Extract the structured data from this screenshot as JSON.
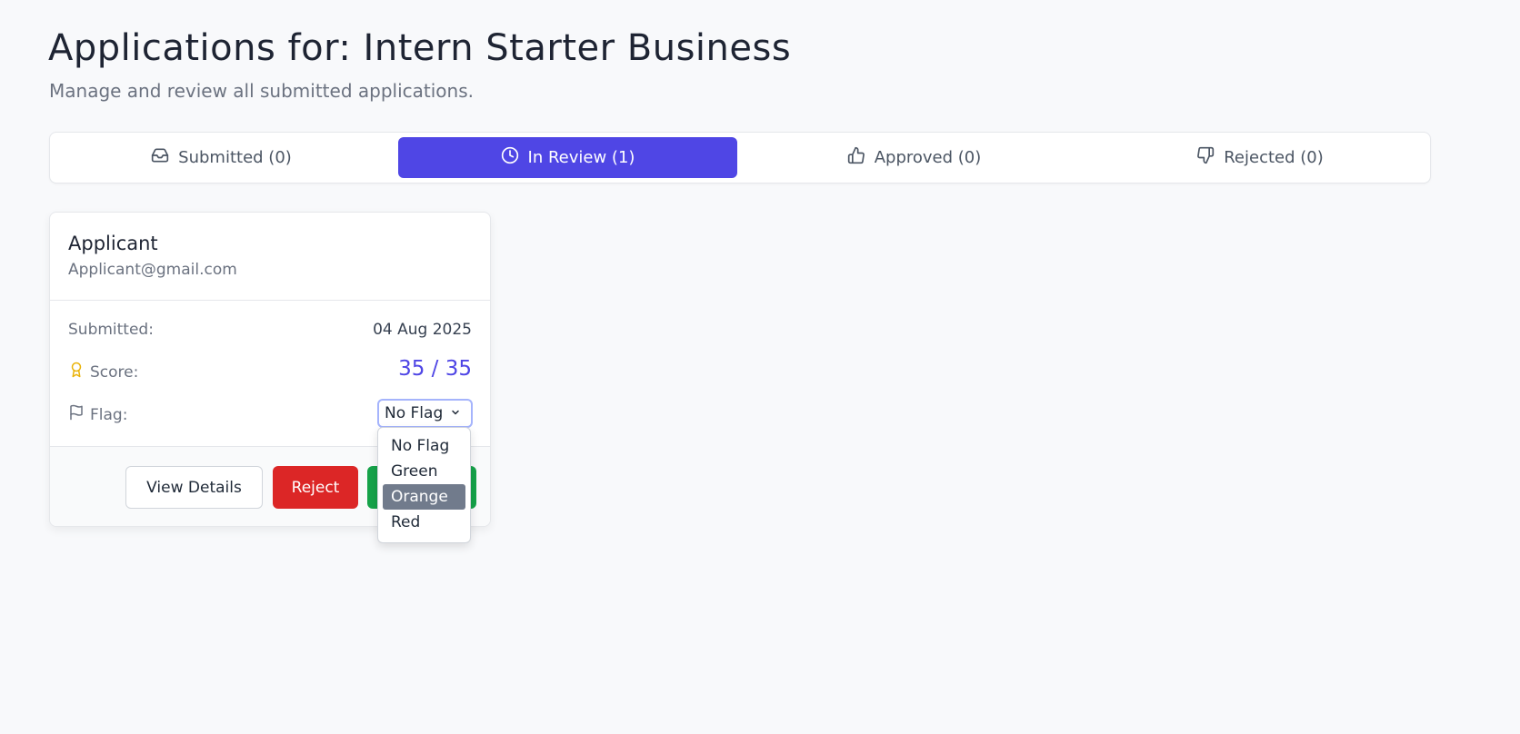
{
  "header": {
    "title": "Applications for: Intern Starter Business",
    "subtitle": "Manage and review all submitted applications."
  },
  "tabs": [
    {
      "label": "Submitted (0)",
      "icon": "inbox-icon",
      "active": false
    },
    {
      "label": "In Review (1)",
      "icon": "clock-icon",
      "active": true
    },
    {
      "label": "Approved (0)",
      "icon": "thumbs-up-icon",
      "active": false
    },
    {
      "label": "Rejected (0)",
      "icon": "thumbs-down-icon",
      "active": false
    }
  ],
  "card": {
    "name": "Applicant",
    "email": "Applicant@gmail.com",
    "submitted_label": "Submitted:",
    "submitted_value": "04 Aug 2025",
    "score_label": "Score:",
    "score_value": "35 / 35",
    "flag_label": "Flag:",
    "flag_value": "No Flag",
    "buttons": {
      "view": "View Details",
      "reject": "Reject"
    }
  },
  "flag_dropdown": {
    "options": [
      "No Flag",
      "Green",
      "Orange",
      "Red"
    ],
    "highlighted": "Orange"
  },
  "colors": {
    "accent": "#4f46e5",
    "reject": "#dc2626",
    "approve": "#16a34a",
    "award_icon": "#eab308",
    "highlight": "#717b8c"
  }
}
